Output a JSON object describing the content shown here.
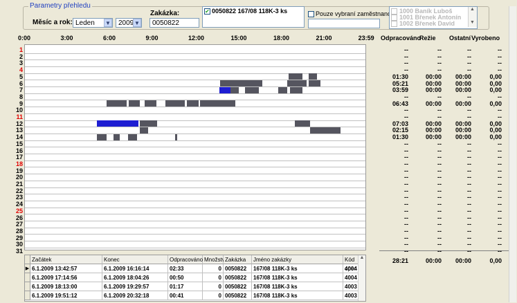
{
  "filter": {
    "group_title": "Parametry přehledu",
    "month_year_label": "Měsíc a rok:",
    "month_value": "Leden",
    "year_value": "2009",
    "order_label": "Zakázka:",
    "order_value": "0050822",
    "order_selected": "0050822 167/08  118K-3 ks",
    "only_selected_label": "Pouze vybraní zaměstnanci",
    "employees": [
      "1000 Baník Luboš",
      "1001 Břenek Antonín",
      "1002 Břenek David"
    ]
  },
  "hours": [
    "0:00",
    "3:00",
    "6:00",
    "9:00",
    "12:00",
    "15:00",
    "18:00",
    "21:00",
    "23:59"
  ],
  "days": [
    "1",
    "2",
    "3",
    "4",
    "5",
    "6",
    "7",
    "8",
    "9",
    "10",
    "11",
    "12",
    "13",
    "14",
    "15",
    "16",
    "17",
    "18",
    "19",
    "20",
    "21",
    "22",
    "23",
    "24",
    "25",
    "26",
    "27",
    "28",
    "29",
    "30",
    "31"
  ],
  "weekend_days": [
    "1",
    "4",
    "11",
    "18",
    "25"
  ],
  "stats_headers": [
    "Odpracováno",
    "Režie",
    "Ostatní",
    "Vyrobeno"
  ],
  "stats_rows": [
    [
      "--",
      "--",
      "--",
      "--"
    ],
    [
      "--",
      "--",
      "--",
      "--"
    ],
    [
      "--",
      "--",
      "--",
      "--"
    ],
    [
      "--",
      "--",
      "--",
      "--"
    ],
    [
      "01:30",
      "00:00",
      "00:00",
      "0,00"
    ],
    [
      "05:21",
      "00:00",
      "00:00",
      "0,00"
    ],
    [
      "03:59",
      "00:00",
      "00:00",
      "0,00"
    ],
    [
      "--",
      "--",
      "--",
      "--"
    ],
    [
      "06:43",
      "00:00",
      "00:00",
      "0,00"
    ],
    [
      "--",
      "--",
      "--",
      "--"
    ],
    [
      "--",
      "--",
      "--",
      "--"
    ],
    [
      "07:03",
      "00:00",
      "00:00",
      "0,00"
    ],
    [
      "02:15",
      "00:00",
      "00:00",
      "0,00"
    ],
    [
      "01:30",
      "00:00",
      "00:00",
      "0,00"
    ],
    [
      "--",
      "--",
      "--",
      "--"
    ],
    [
      "--",
      "--",
      "--",
      "--"
    ],
    [
      "--",
      "--",
      "--",
      "--"
    ],
    [
      "--",
      "--",
      "--",
      "--"
    ],
    [
      "--",
      "--",
      "--",
      "--"
    ],
    [
      "--",
      "--",
      "--",
      "--"
    ],
    [
      "--",
      "--",
      "--",
      "--"
    ],
    [
      "--",
      "--",
      "--",
      "--"
    ],
    [
      "--",
      "--",
      "--",
      "--"
    ],
    [
      "--",
      "--",
      "--",
      "--"
    ],
    [
      "--",
      "--",
      "--",
      "--"
    ],
    [
      "--",
      "--",
      "--",
      "--"
    ],
    [
      "--",
      "--",
      "--",
      "--"
    ],
    [
      "--",
      "--",
      "--",
      "--"
    ],
    [
      "--",
      "--",
      "--",
      "--"
    ],
    [
      "--",
      "--",
      "--",
      "--"
    ],
    [
      "--",
      "--",
      "--",
      "--"
    ]
  ],
  "stats_total": [
    "28:21",
    "00:00",
    "00:00",
    "0,00"
  ],
  "timeline_segments": [
    {
      "day": 5,
      "start": "18:35",
      "end": "19:35",
      "color": "#55555f"
    },
    {
      "day": 5,
      "start": "20:00",
      "end": "20:35",
      "color": "#55555f"
    },
    {
      "day": 6,
      "start": "13:45",
      "end": "16:45",
      "color": "#55555f"
    },
    {
      "day": 6,
      "start": "18:30",
      "end": "19:50",
      "color": "#55555f"
    },
    {
      "day": 6,
      "start": "20:00",
      "end": "20:50",
      "color": "#55555f"
    },
    {
      "day": 7,
      "start": "13:42",
      "end": "14:30",
      "color": "#1e1ed2"
    },
    {
      "day": 7,
      "start": "14:30",
      "end": "15:05",
      "color": "#55555f"
    },
    {
      "day": 7,
      "start": "15:30",
      "end": "16:30",
      "color": "#55555f"
    },
    {
      "day": 7,
      "start": "17:50",
      "end": "18:30",
      "color": "#55555f"
    },
    {
      "day": 7,
      "start": "18:40",
      "end": "19:35",
      "color": "#55555f"
    },
    {
      "day": 9,
      "start": "5:45",
      "end": "7:10",
      "color": "#55555f"
    },
    {
      "day": 9,
      "start": "7:20",
      "end": "8:05",
      "color": "#55555f"
    },
    {
      "day": 9,
      "start": "8:25",
      "end": "9:15",
      "color": "#55555f"
    },
    {
      "day": 9,
      "start": "9:55",
      "end": "11:15",
      "color": "#55555f"
    },
    {
      "day": 9,
      "start": "11:25",
      "end": "12:15",
      "color": "#55555f"
    },
    {
      "day": 9,
      "start": "12:20",
      "end": "14:20",
      "color": "#55555f"
    },
    {
      "day": 9,
      "start": "14:20",
      "end": "14:50",
      "color": "#55555f"
    },
    {
      "day": 12,
      "start": "5:05",
      "end": "8:00",
      "color": "#1e1ed2"
    },
    {
      "day": 12,
      "start": "8:05",
      "end": "9:20",
      "color": "#55555f"
    },
    {
      "day": 12,
      "start": "19:00",
      "end": "20:05",
      "color": "#55555f"
    },
    {
      "day": 13,
      "start": "8:05",
      "end": "8:40",
      "color": "#55555f"
    },
    {
      "day": 13,
      "start": "20:05",
      "end": "22:15",
      "color": "#55555f"
    },
    {
      "day": 14,
      "start": "5:05",
      "end": "5:45",
      "color": "#55555f"
    },
    {
      "day": 14,
      "start": "6:15",
      "end": "6:40",
      "color": "#55555f"
    },
    {
      "day": 14,
      "start": "7:15",
      "end": "7:55",
      "color": "#55555f"
    },
    {
      "day": 14,
      "start": "10:35",
      "end": "10:45",
      "color": "#55555f"
    }
  ],
  "table": {
    "columns": [
      "Začátek",
      "Konec",
      "Odpracováno",
      "Množství",
      "Zakázka",
      "Jméno zakázky",
      "Kód oper"
    ],
    "rows": [
      [
        "6.1.2009 13:42:57",
        "6.1.2009 16:16:14",
        "02:33",
        "0",
        "0050822",
        "167/08  118K-3 ks",
        "4004"
      ],
      [
        "6.1.2009 17:14:56",
        "6.1.2009 18:04:26",
        "00:50",
        "0",
        "0050822",
        "167/08  118K-3 ks",
        "4004"
      ],
      [
        "6.1.2009 18:13:00",
        "6.1.2009 19:29:57",
        "01:17",
        "0",
        "0050822",
        "167/08  118K-3 ks",
        "4003"
      ],
      [
        "6.1.2009 19:51:12",
        "6.1.2009 20:32:18",
        "00:41",
        "0",
        "0050822",
        "167/08  118K-3 ks",
        "4003"
      ]
    ]
  }
}
